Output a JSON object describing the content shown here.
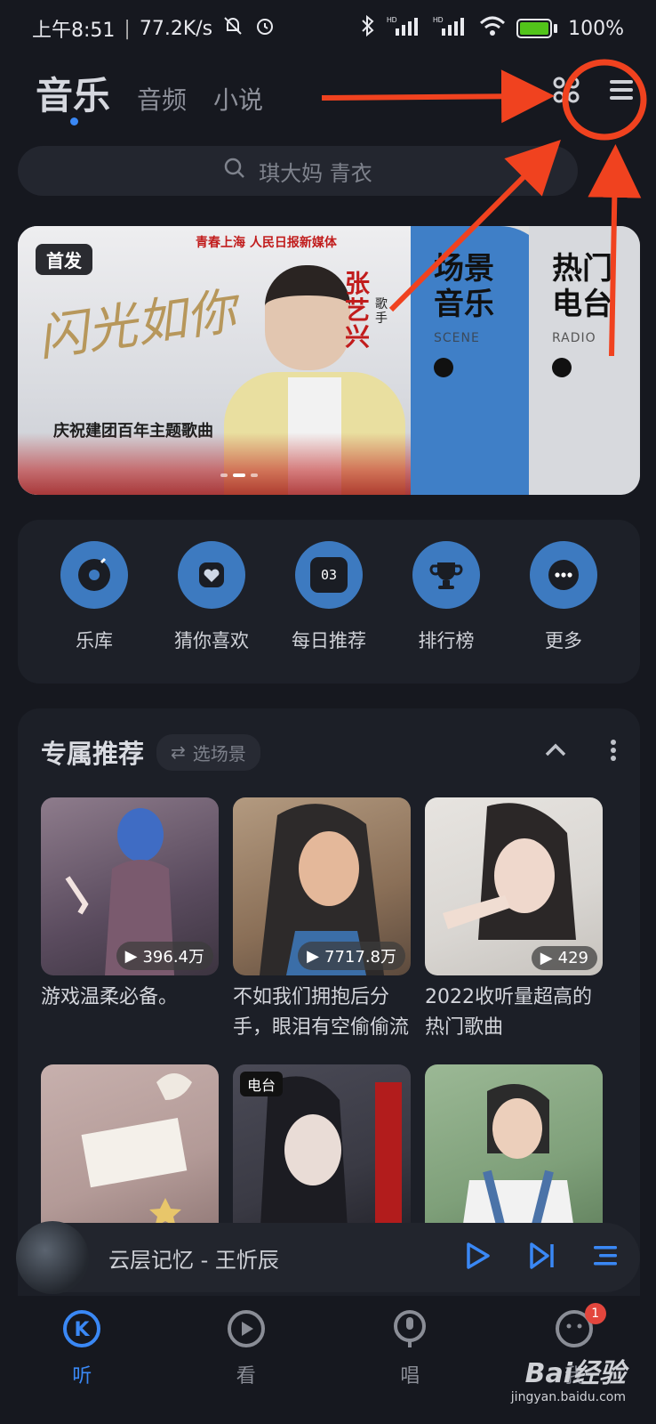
{
  "status_bar": {
    "time": "上午8:51",
    "speed": "77.2K/s",
    "battery": "100%",
    "network_label": "HD"
  },
  "top_nav": {
    "tabs": [
      {
        "label": "音乐",
        "active": true
      },
      {
        "label": "音频",
        "active": false
      },
      {
        "label": "小说",
        "active": false
      }
    ]
  },
  "search": {
    "placeholder": "琪大妈 青衣"
  },
  "banner": {
    "badge": "首发",
    "script_title": "闪光如你",
    "subtitle": "庆祝建团百年主题歌曲",
    "artist": "张艺兴",
    "artist_role": "歌手",
    "logos": "青春上海  人民日报新媒体",
    "cards": [
      {
        "title": "场景音乐",
        "subtitle": "SCENE",
        "color": "#3f7fc7"
      },
      {
        "title": "热门电台",
        "subtitle": "RADIO",
        "color": "#d7d9dd"
      }
    ]
  },
  "shortcuts": [
    {
      "label": "乐库",
      "icon": "disc-icon"
    },
    {
      "label": "猜你喜欢",
      "icon": "heart-card-icon"
    },
    {
      "label": "每日推荐",
      "icon": "calendar-03-icon",
      "icon_text": "03"
    },
    {
      "label": "排行榜",
      "icon": "trophy-icon"
    },
    {
      "label": "更多",
      "icon": "more-dots-icon"
    }
  ],
  "recommend": {
    "title": "专属推荐",
    "scene_chip": "选场景",
    "items": [
      {
        "title": "游戏温柔必备。",
        "plays": "396.4万",
        "bg": "#6b5b6a",
        "accent": "#3f6cc4"
      },
      {
        "title": "不如我们拥抱后分手，眼泪有空偷偷流",
        "plays": "7717.8万",
        "bg": "#8a6f57",
        "accent": "#2d2a2a"
      },
      {
        "title": "2022收听量超高的热门歌曲",
        "plays": "429",
        "bg": "#d9d6d2",
        "accent": "#2b2727"
      },
      {
        "title": "",
        "plays": "",
        "bg": "#b39a97",
        "accent": "#f4f0ea"
      },
      {
        "title": "",
        "plays": "",
        "tag": "电台",
        "bg": "#3a3a44",
        "accent": "#b21c1c"
      },
      {
        "title": "",
        "plays": "",
        "bg": "#7fa07a",
        "accent": "#2b2b2b"
      }
    ]
  },
  "player": {
    "track": "云层记忆  -  王忻辰"
  },
  "bottom_nav": [
    {
      "label": "听",
      "active": true
    },
    {
      "label": "看",
      "active": false
    },
    {
      "label": "唱",
      "active": false
    },
    {
      "label": "我",
      "active": false,
      "badge": "1"
    }
  ],
  "watermark": {
    "brand": "Bai经验",
    "url": "jingyan.baidu.com"
  },
  "colors": {
    "accent": "#3a88f5",
    "annotation": "#f0421f"
  }
}
